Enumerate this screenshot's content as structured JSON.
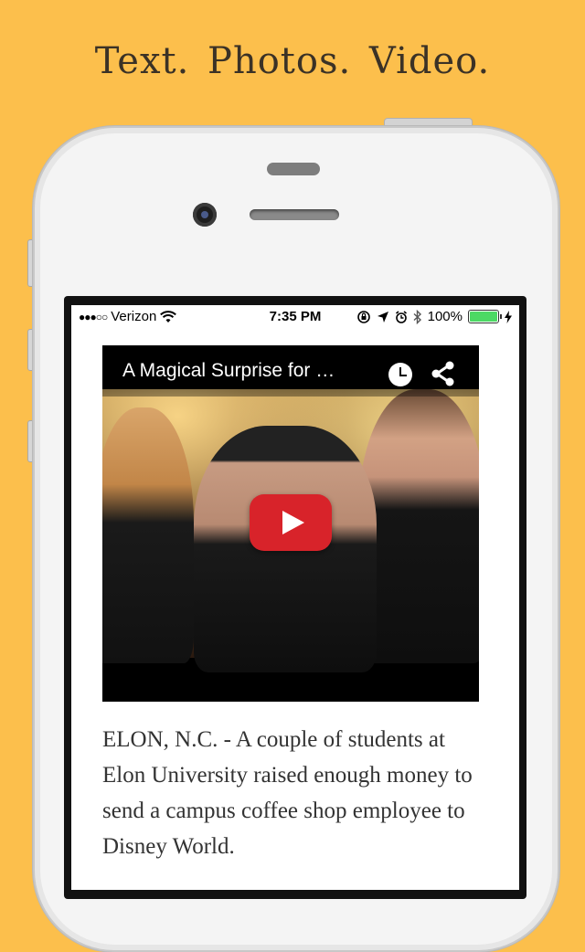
{
  "headline": "Text.  Photos.  Video.",
  "status_bar": {
    "carrier": "Verizon",
    "signal_dots": "●●●○○",
    "time": "7:35 PM",
    "battery": "100%"
  },
  "video": {
    "title": "A Magical Surprise for …",
    "icons": [
      "clock-icon",
      "share-icon",
      "play-icon"
    ],
    "play_color": "#d8232a"
  },
  "article": {
    "text": "ELON, N.C. - A couple of students at Elon University raised enough money to send a campus coffee shop employee to Disney World."
  },
  "colors": {
    "background": "#fcbf4c",
    "battery": "#4cd964"
  }
}
